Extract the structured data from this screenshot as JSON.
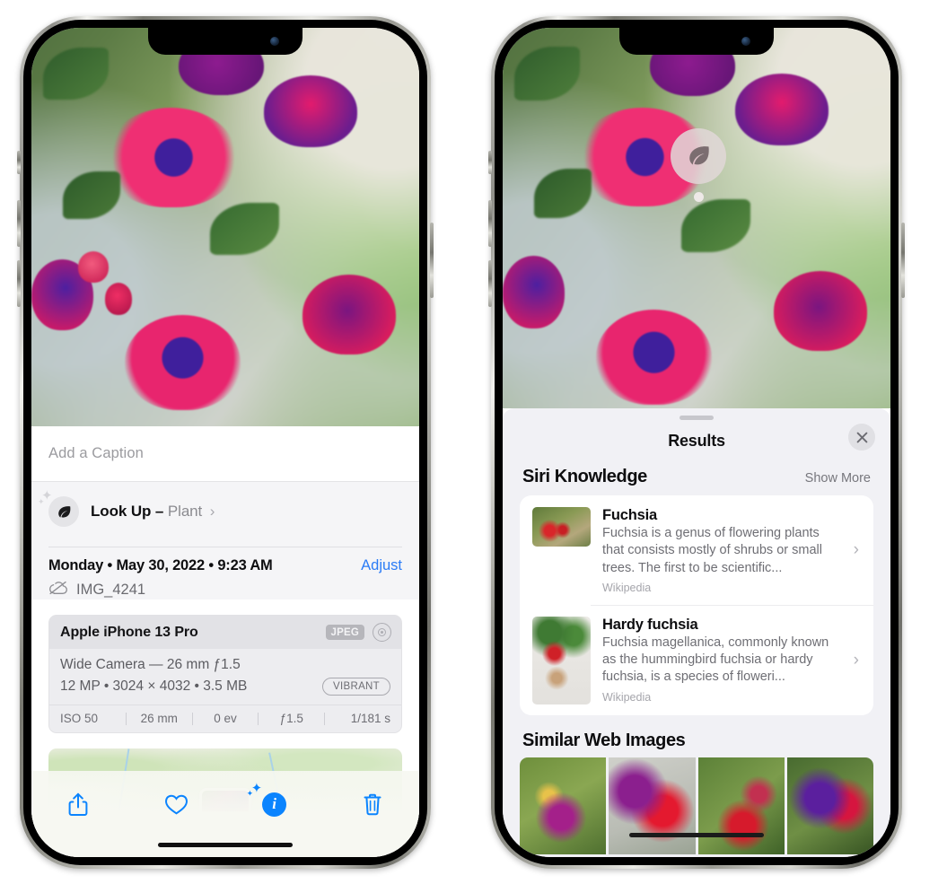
{
  "left_phone": {
    "name": "iphone-photos-info-view",
    "caption": {
      "placeholder": "Add a Caption",
      "value": ""
    },
    "lookup": {
      "label": "Look Up",
      "dash": "–",
      "subject": "Plant",
      "chevron": "›",
      "icon": "leaf-icon"
    },
    "metadata": {
      "date": "Monday • May 30, 2022 • 9:23 AM",
      "adjust_label": "Adjust",
      "filename": "IMG_4241",
      "cloud_icon": "cloud-slash-icon"
    },
    "exif": {
      "device": "Apple iPhone 13 Pro",
      "format_badge": "JPEG",
      "hdr_icon": "hdr-target-icon",
      "lens": "Wide Camera — 26 mm ƒ1.5",
      "size": "12 MP • 3024 × 4032 • 3.5 MB",
      "style_pill": "VIBRANT",
      "stats": [
        "ISO 50",
        "26 mm",
        "0 ev",
        "ƒ1.5",
        "1/181 s"
      ]
    },
    "toolbar": [
      {
        "name": "share-button",
        "icon": "share-icon"
      },
      {
        "name": "favorite-button",
        "icon": "heart-icon"
      },
      {
        "name": "info-button",
        "icon": "info-sparkle-icon"
      },
      {
        "name": "delete-button",
        "icon": "trash-icon"
      }
    ]
  },
  "right_phone": {
    "name": "iphone-visual-lookup-results",
    "lookup_badge": {
      "icon": "leaf-icon"
    },
    "sheet": {
      "title": "Results",
      "close_icon": "close-icon",
      "siri_section": {
        "title": "Siri Knowledge",
        "action": "Show More"
      },
      "knowledge": [
        {
          "title": "Fuchsia",
          "description": "Fuchsia is a genus of flowering plants that consists mostly of shrubs or small trees. The first to be scientific...",
          "source": "Wikipedia",
          "chevron": "›"
        },
        {
          "title": "Hardy fuchsia",
          "description": "Fuchsia magellanica, commonly known as the hummingbird fuchsia or hardy fuchsia, is a species of floweri...",
          "source": "Wikipedia",
          "chevron": "›"
        }
      ],
      "web_section": {
        "title": "Similar Web Images"
      }
    }
  },
  "colors": {
    "accent_blue": "#0b84fe",
    "link_blue": "#2b7cf6",
    "sheet_bg": "#f1f1f5",
    "card_bg": "#ffffff",
    "secondary_text": "#6e6e74"
  }
}
